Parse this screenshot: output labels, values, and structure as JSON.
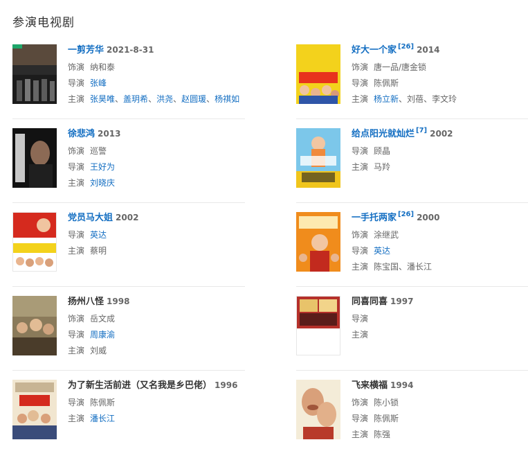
{
  "section": {
    "heading": "参演电视剧"
  },
  "labels": {
    "role": "饰演",
    "director": "导演",
    "cast": "主演",
    "sep": "、"
  },
  "shows": [
    {
      "title": "一剪芳华",
      "ref": "",
      "year": "2021-8-31",
      "role": "纳和泰",
      "director": "张峰",
      "cast": [
        "张昊唯",
        "盖玥希",
        "洪尧",
        "赵圆瑗",
        "杨祺如"
      ]
    },
    {
      "title": "好大一个家",
      "ref": "[26]",
      "year": "2014",
      "role": "唐一品/唐金锁",
      "director": "陈佩斯",
      "cast": [
        "杨立新",
        "刘蓓",
        "李文玲"
      ]
    },
    {
      "title": "徐悲鸿",
      "ref": "",
      "year": "2013",
      "role": "巡警",
      "director": "王好为",
      "cast": [
        "刘晓庆"
      ]
    },
    {
      "title": "给点阳光就灿烂",
      "ref": "[7]",
      "year": "2002",
      "director": "顾晶",
      "cast": [
        "马羚"
      ]
    },
    {
      "title": "党员马大姐",
      "ref": "",
      "year": "2002",
      "director": "英达",
      "cast": [
        "蔡明"
      ]
    },
    {
      "title": "一手托两家",
      "ref": "[26]",
      "year": "2000",
      "role": "涂继武",
      "director": "英达",
      "cast": [
        "陈宝国",
        "潘长江"
      ]
    },
    {
      "title": "扬州八怪",
      "ref": "",
      "year": "1998",
      "role": "岳文成",
      "director": "周康渝",
      "cast": [
        "刘威"
      ]
    },
    {
      "title": "同喜同喜",
      "ref": "",
      "year": "1997",
      "director": "",
      "cast": []
    },
    {
      "title": "为了新生活前进（又名我是乡巴佬）",
      "ref": "",
      "year": "1996",
      "director": "陈佩斯",
      "cast": [
        "潘长江"
      ]
    },
    {
      "title": "飞来横福",
      "ref": "",
      "year": "1994",
      "role": "陈小锁",
      "director": "陈佩斯",
      "cast": [
        "陈强"
      ]
    }
  ],
  "colors": {
    "link": "#136ec2",
    "divider": "#e8e8e8"
  }
}
